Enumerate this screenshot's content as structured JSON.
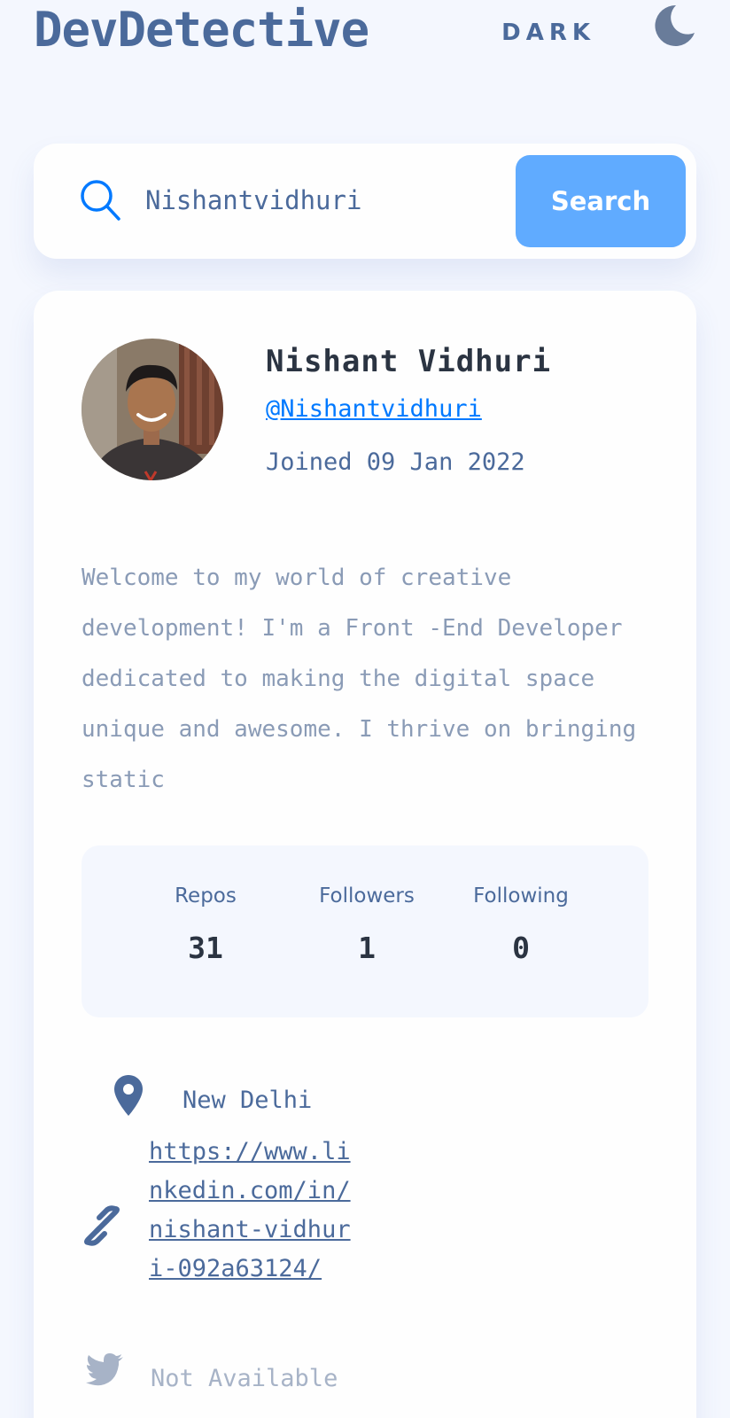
{
  "header": {
    "logo": "DevDetective",
    "theme_label": "DARK",
    "theme_icon": "moon-icon"
  },
  "search": {
    "value": "Nishantvidhuri",
    "button_label": "Search",
    "icon": "search-icon"
  },
  "profile": {
    "name": "Nishant Vidhuri",
    "login": "@Nishantvidhuri",
    "joined": "Joined 09 Jan 2022",
    "bio": "Welcome to my world of creative development! I'm a Front -End Developer dedicated to making the digital space unique and awesome. I thrive on bringing static",
    "stats": [
      {
        "label": "Repos",
        "value": "31"
      },
      {
        "label": "Followers",
        "value": "1"
      },
      {
        "label": "Following",
        "value": "0"
      }
    ],
    "location": "New Delhi",
    "blog": "https://www.linkedin.com/in/nishant-vidhuri-092a63124/",
    "twitter": "Not Available"
  },
  "colors": {
    "background": "#f4f7fe",
    "card": "#fefefe",
    "accent": "#0079ff",
    "button": "#60abff",
    "text_primary": "#2b3442",
    "text_secondary": "#4b6a9b",
    "text_muted": "#8a9bb6"
  }
}
